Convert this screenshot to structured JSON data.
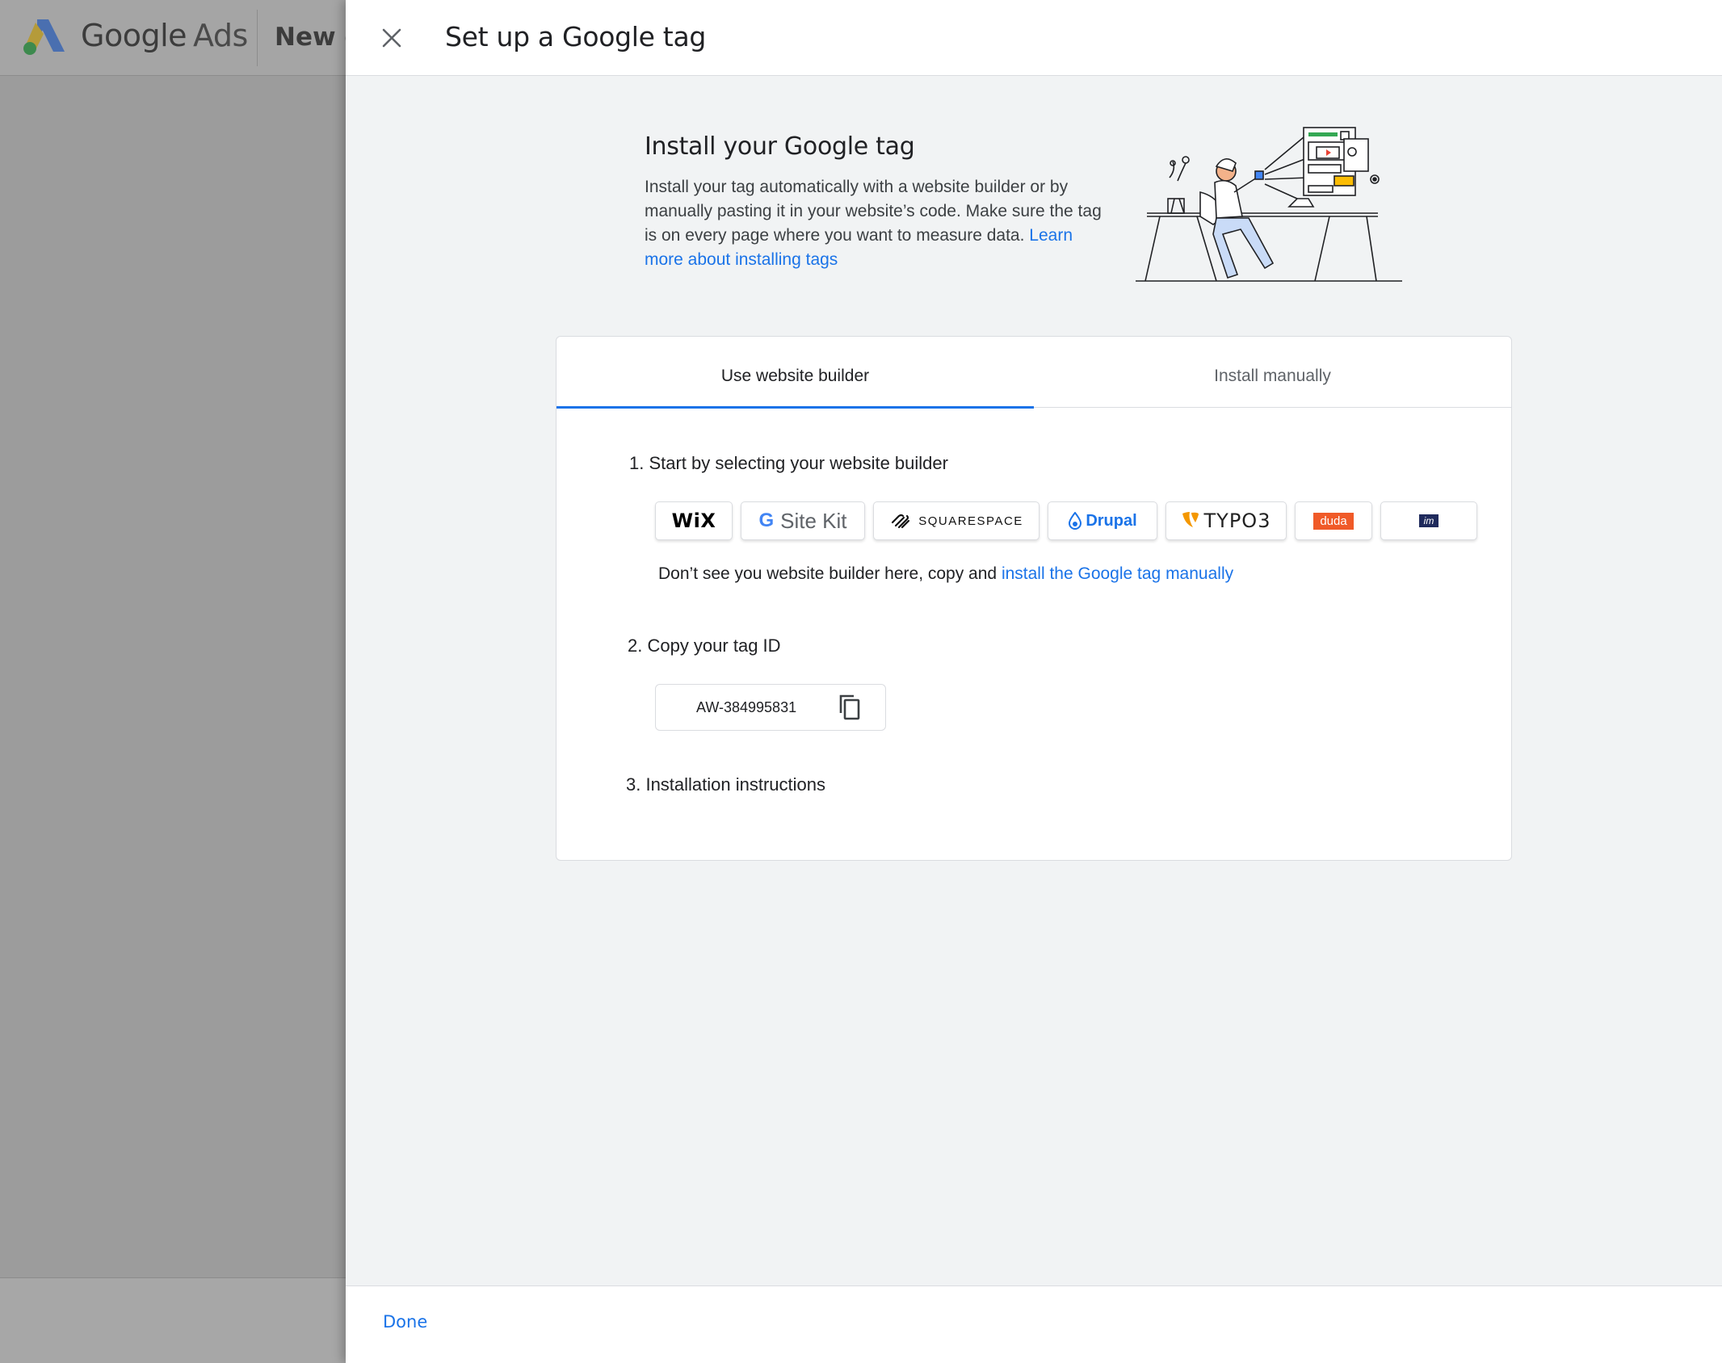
{
  "background_app": {
    "brand_google": "Google",
    "brand_ads": "Ads",
    "tab_label": "New c"
  },
  "dialog": {
    "title": "Set up a Google tag",
    "close_icon": "close-icon",
    "done_label": "Done"
  },
  "intro": {
    "title": "Install your Google tag",
    "text": "Install your tag automatically with a website builder or by manually pasting it in your website’s code. Make sure the tag is on every page where you want to measure data.",
    "link": "Learn more about installing tags"
  },
  "tabs": [
    {
      "label": "Use website builder",
      "active": true
    },
    {
      "label": "Install manually",
      "active": false
    }
  ],
  "steps": {
    "step1": "1.  Start by selecting your website builder",
    "step2": "2.  Copy your tag ID",
    "step3": "3.  Installation instructions"
  },
  "builders": {
    "wix": "WiX",
    "sitekit_g": "G",
    "sitekit": "Site Kit",
    "squarespace": "SQUARESPACE",
    "drupal": "Drupal",
    "typo3": "TYPO3",
    "duda": "duda",
    "other": "im"
  },
  "note": {
    "text": "Don’t see you website builder here, copy and",
    "link": "install the Google tag manually"
  },
  "tag_id": {
    "value": "AW-384995831",
    "copy_icon": "copy-icon"
  },
  "colors": {
    "accent": "#1a73e8",
    "panel_bg": "#f1f3f4",
    "overlay": "#9c9c9c"
  }
}
